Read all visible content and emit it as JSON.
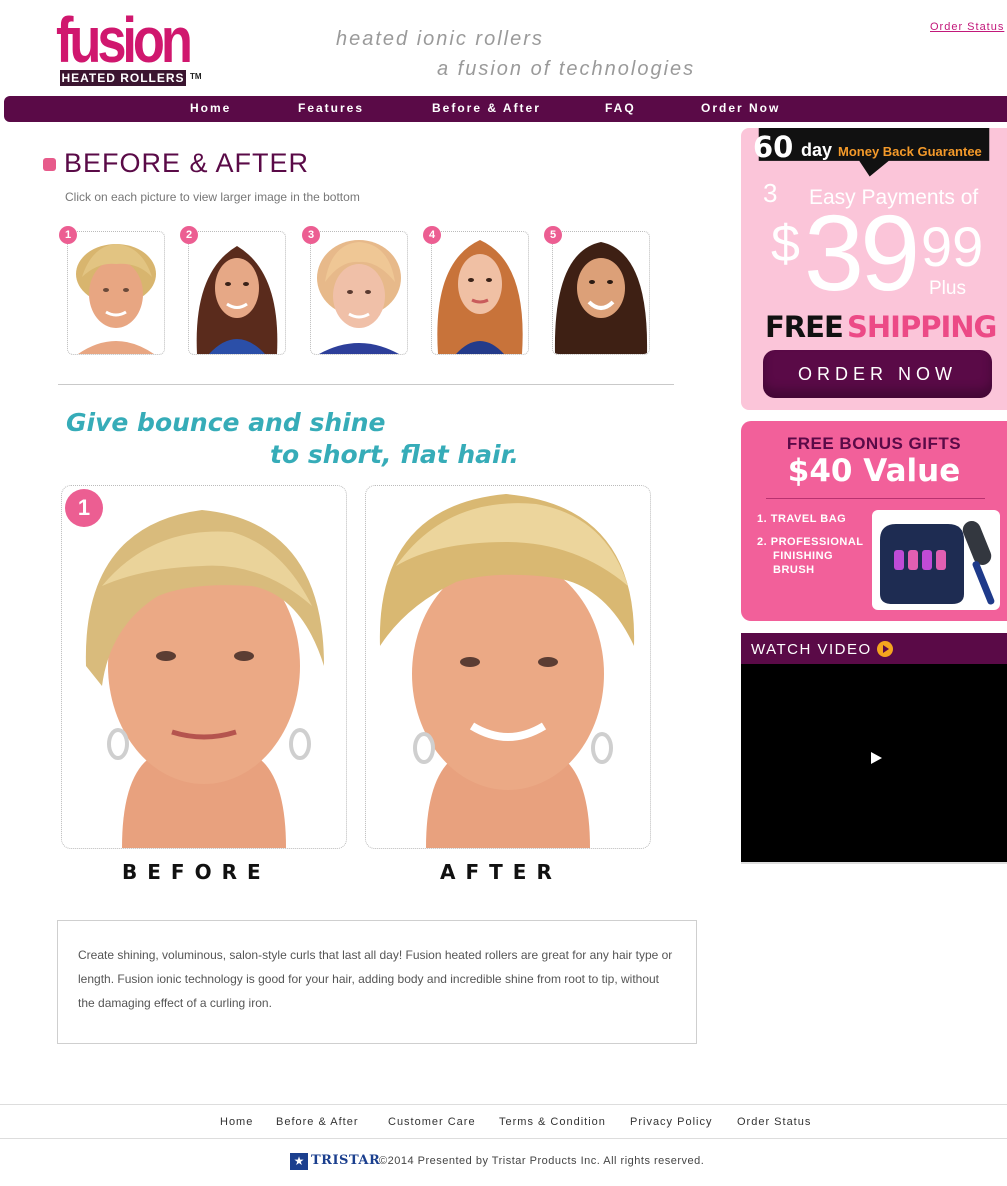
{
  "header": {
    "logo_word": "fusion",
    "logo_subtitle": "HEATED ROLLERS",
    "logo_tm": "TM",
    "tagline_1": "heated ionic rollers",
    "tagline_2": "a fusion of technologies",
    "order_status_link": "Order Status"
  },
  "nav": {
    "items": [
      {
        "label": "Home"
      },
      {
        "label": "Features"
      },
      {
        "label": "Before & After"
      },
      {
        "label": "FAQ"
      },
      {
        "label": "Order Now"
      }
    ]
  },
  "main": {
    "section_title": "BEFORE & AFTER",
    "instruction": "Click on each picture to view larger image in the bottom",
    "thumbnails": [
      {
        "number": "1"
      },
      {
        "number": "2"
      },
      {
        "number": "3"
      },
      {
        "number": "4"
      },
      {
        "number": "5"
      }
    ],
    "headline_1": "Give bounce and shine",
    "headline_2": "to short, flat hair.",
    "selected_number": "1",
    "before_label": "BEFORE",
    "after_label": "AFTER",
    "description": "Create shining, voluminous, salon-style curls that last all day! Fusion heated rollers are great for any hair type or length. Fusion ionic technology is good for your hair, adding body and incredible shine from root to tip, without the damaging effect of a curling iron."
  },
  "promo": {
    "days": "60",
    "day_word": "day",
    "guarantee": "Money Back Guarantee",
    "payments_count": "3",
    "easy_payments": "Easy Payments of",
    "dollar_sign": "$",
    "price_whole": "39",
    "price_cents": "99",
    "plus": "Plus",
    "free": "FREE",
    "shipping": "SHIPPING",
    "order_button": "ORDER NOW"
  },
  "bonus": {
    "title": "FREE BONUS GIFTS",
    "value": "$40 Value",
    "items": [
      {
        "label": "1. TRAVEL BAG"
      },
      {
        "label": "2. PROFESSIONAL"
      },
      {
        "label": "FINISHING"
      },
      {
        "label": "BRUSH"
      }
    ]
  },
  "video": {
    "title": "WATCH VIDEO"
  },
  "footer": {
    "links": [
      {
        "label": "Home"
      },
      {
        "label": "Before & After"
      },
      {
        "label": "Customer Care"
      },
      {
        "label": "Terms & Condition"
      },
      {
        "label": "Privacy Policy"
      },
      {
        "label": "Order Status"
      }
    ],
    "brand": "TRISTAR",
    "copyright": "©2014 Presented by Tristar Products Inc. All rights reserved."
  },
  "colors": {
    "brand_purple": "#5a0a47",
    "brand_pink": "#d0176e",
    "accent_pink": "#ec5e92",
    "headline_teal": "#36acb8"
  }
}
